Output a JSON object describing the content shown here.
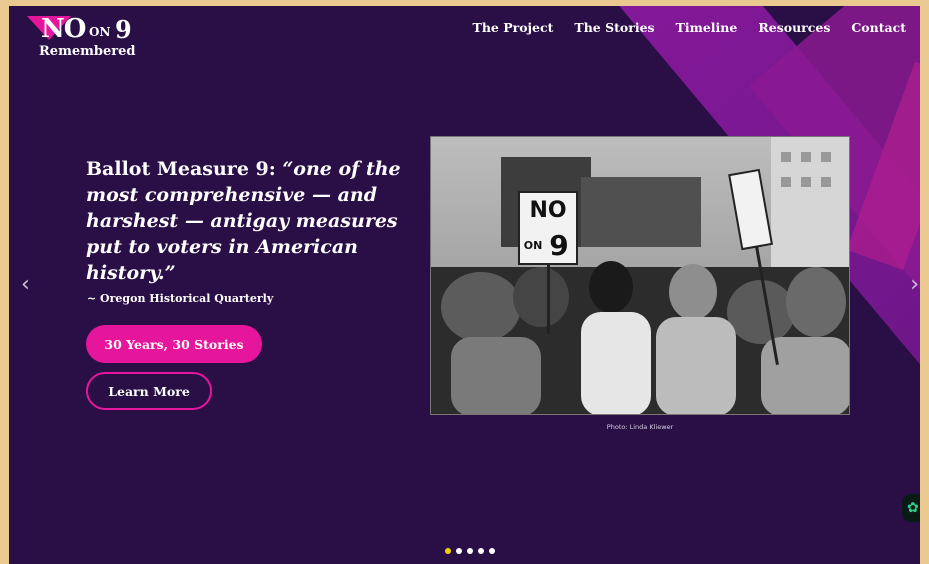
{
  "logo": {
    "no": "NO",
    "on": "ON",
    "nine": "9",
    "remembered": "Remembered"
  },
  "nav": [
    {
      "label": "The Project"
    },
    {
      "label": "The Stories"
    },
    {
      "label": "Timeline"
    },
    {
      "label": "Resources"
    },
    {
      "label": "Contact"
    }
  ],
  "hero": {
    "headline_lead": "Ballot Measure 9: ",
    "headline_quote": "“one of the most comprehensive — and harshest — antigay measures put to voters in American history.”",
    "citation": "~ Oregon Historical Quarterly",
    "primary_button": "30 Years, 30 Stories",
    "secondary_button": "Learn More",
    "sign_text_1": "NO",
    "sign_text_2": "ON",
    "sign_text_3": "9"
  },
  "photo": {
    "caption": "Photo: Linda Kliewer"
  },
  "carousel": {
    "prev_icon": "‹",
    "next_icon": "›",
    "slides": 5,
    "active_index": 0
  },
  "widget": {
    "icon": "✿"
  },
  "colors": {
    "background": "#2a0e46",
    "accent": "#e5169b",
    "active_dot": "#f2d400"
  }
}
